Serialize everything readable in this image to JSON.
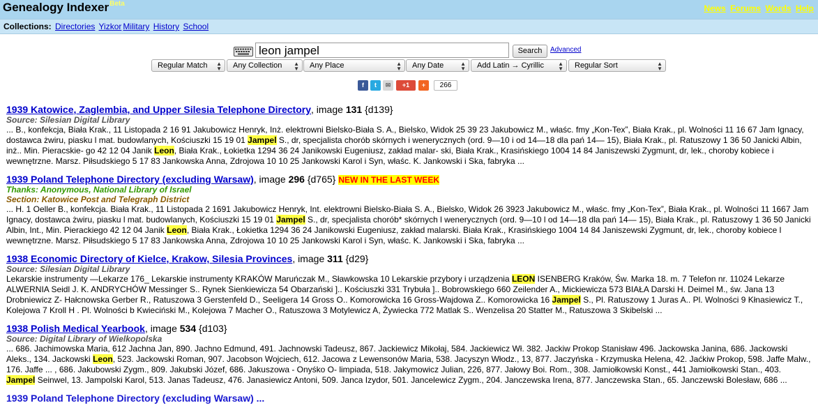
{
  "header": {
    "brand": "Genealogy Indexer",
    "beta": "Beta",
    "links": [
      "News",
      "Forums",
      "Words",
      "Help"
    ]
  },
  "collections": {
    "label": "Collections:",
    "items": [
      "Directories",
      "Yizkor",
      "Military",
      "History",
      "School"
    ]
  },
  "search": {
    "query": "leon jampel",
    "button": "Search",
    "advanced": "Advanced"
  },
  "filters": [
    "Regular Match",
    "Any Collection",
    "Any Place",
    "Any Date",
    "Add Latin → Cyrillic",
    "Regular Sort"
  ],
  "share": {
    "count": "266",
    "gplus": "+1"
  },
  "results": [
    {
      "title": "1939 Katowice, Zaglembia, and Upper Silesia Telephone Directory",
      "image_label": ", image",
      "image_num": "131",
      "doc": "{d139}",
      "source": "Source: Silesian Digital Library",
      "snippet": [
        {
          "t": "... B., konfekcja, Biała Krak., 11 Listopada 2 16 91 Jakubowicz Henryk, Inż. elektrowni Bielsko-Biała S. A., Bielsko, Widok 25 39 23 Jakubowicz M., właśc. fmy „Kon-Tex”, Biała Krak., pl. Wolności 11 16 67 Jam Ignacy, dostawca żwiru, piasku l mat. budowlanych, Kościuszki 15 19 01 "
        },
        {
          "t": "Jampel",
          "hl": true
        },
        {
          "t": " S., dr, specjalista chorób skórnych i wenerycznych (ord. 9—10 i od 14—18 dla pań 14— 15), Biała Krak., pl. Ratuszowy 1 36 50 Janicki Albin, inż.. Min. Pieracskie- go 42 12 04 Janik "
        },
        {
          "t": "Leon",
          "hl": true
        },
        {
          "t": ", Biała Krak., Łokietka 1294 36 24 Janikowski Eugeniusz, zakład malar- ski, Biała Krak., Krasińskiego 1004 14 84 Janiszewski Zygmunt, dr, lek., choroby kobiece i wewnętrzne. Marsz. Piłsudskiego 5 17 83 Jankowska Anna, Zdrojowa 10 10 25 Jankowski Karol i Syn, właśc. K. Jankowski i Ska, fabryka ..."
        }
      ]
    },
    {
      "title": "1939 Poland Telephone Directory (excluding Warsaw)",
      "image_label": ", image",
      "image_num": "296",
      "doc": "{d765}",
      "badge": "NEW IN THE LAST WEEK",
      "thanks": "Thanks: Anonymous, National Library of Israel",
      "section": "Section: Katowice Post and Telegraph District",
      "snippet": [
        {
          "t": "... H. 1 Oeller B., konfekcja. Biała Krak., 11 Listopada 2 1691 Jakubowicz Henryk, Int. elektrowni Bielsko-Biała S. A., Bielsko, Widok 26 3923 Jakubowicz M., właśc. fmy „Kon-Tex”, Biała Krak., pl. Wolności 11 1667 Jam Ignacy, dostawca żwiru, piasku l mat. budowlanych, Kościuszki 15 19 01 "
        },
        {
          "t": "Jampel",
          "hl": true
        },
        {
          "t": " S., dr, specjalista chorób* skórnych l wenerycznych (ord. 9—10 l od 14—18 dla pań 14— 15), Biała Krak., pl. Ratuszowy 1 36 50 Janicki Albin, Int., Min. Pierackiego 42 12 04 Janik "
        },
        {
          "t": "Leon",
          "hl": true
        },
        {
          "t": ", Biała Krak., Łokietka 1294 36 24 Janikowski Eugeniusz, zakład malarski. Biała Krak., Krasińskiego 1004 14 84 Janiszewski Zygmunt, dr, lek., choroby kobiece l wewnętrzne. Marsz. Piłsudskiego 5 17 83 Jankowska Anna, Zdrojowa 10 10 25 Jankowski Karol i Syn, właśc. K. Jankowski i Ska, fabryka ..."
        }
      ]
    },
    {
      "title": "1938 Economic Directory of Kielce, Krakow, Silesia Provinces",
      "image_label": ", image",
      "image_num": "311",
      "doc": "{d29}",
      "source": "Source: Silesian Digital Library",
      "snippet": [
        {
          "t": "Lekarskie instrumenty —Lekarze 176_ Lekarskie instrumenty KRAKÓW Maruńczak M., Sławkowska 10 Lekarskie przybory i urządzenia "
        },
        {
          "t": "LEON",
          "hl": true
        },
        {
          "t": " ISENBERG Kraków, Św. Marka 18. m. 7 Telefon nr. 11024 Lekarze ALWERNIA Seidl J. K. ANDRYCHÓW Messinger S.. Rynek Sienkiewicza 54 Obarzański ].. Kościuszki 331 Trybuła ].. Bobrowskiego 660 Zeilender A., Mickiewicza 573 BIAŁA Darski H. Deimel M., św. Jana 13 Drobniewicz Z- Hałcnowska Gerber R., Ratuszowa 3 Gerstenfeld D., Seeligera 14 Gross O.. Komorowicka 16 Gross-Wajdowa Z.. Komorowicka 16 "
        },
        {
          "t": "Jampel",
          "hl": true
        },
        {
          "t": " S., Pl. Ratuszowy 1 Juras A.. Pl. Wolności 9 Kłnasiewicz T., Kolejowa 7 Kroll H . Pl. Wolności b Kwieciński M., Kolejowa 7 Macher O., Ratuszowa 3 Motylewicz A, Żywiecka 772 Matlak S.. Wenzelisa 20 Statter M., Ratuszowa 3 Skibelski ..."
        }
      ]
    },
    {
      "title": "1938 Polish Medical Yearbook",
      "image_label": ", image",
      "image_num": "534",
      "doc": "{d103}",
      "source": "Source: Digital Library of Wielkopolska",
      "snippet": [
        {
          "t": "... 686. Jachimowska Maria, 612 Jachna Jan, 890. Jachno Edmund, 491. Jachnowski Tadeusz, 867. Jackiewicz Mikołaj, 584. Jackiewicz Wł. 382. Jackiw Prokop Stanisław 496. Jackowska Janina, 686. Jackowski Aleks., 134. Jackowski "
        },
        {
          "t": "Leon",
          "hl": true
        },
        {
          "t": ", 523. Jackowski Roman, 907. Jacobson Wojciech, 612. Jacowa z Lewensonów Maria, 538. Jacyszyn Włodz., 13, 877. Jaczyńska - Krzymuska Helena, 42. Jaćkiw Prokop, 598. Jaffe Malw., 176. Jaffe ... , 686. Jakubowski Zygm., 809. Jakubski Józef, 686. Jakuszowa - Onyśko O- limpiada, 518. Jakymowicz Julian, 226, 877. Jałowy Boi. Rom., 308. Jamiołkowski Konst., 441 Jamiołkowski Stan., 403. "
        },
        {
          "t": "Jampel",
          "hl": true
        },
        {
          "t": " Seinwel, 13. Jampolski Karol, 513. Janas Tadeusz, 476. Janasiewicz Antoni, 509. Janca Izydor, 501. Jancelewicz Zygm., 204. Janczewska Irena, 877. Janczewska Stan., 65. Janczewski Bolesław, 686 ..."
        }
      ]
    }
  ],
  "cutoff_title": "1939 Poland Telephone Directory (excluding Warsaw) ..."
}
